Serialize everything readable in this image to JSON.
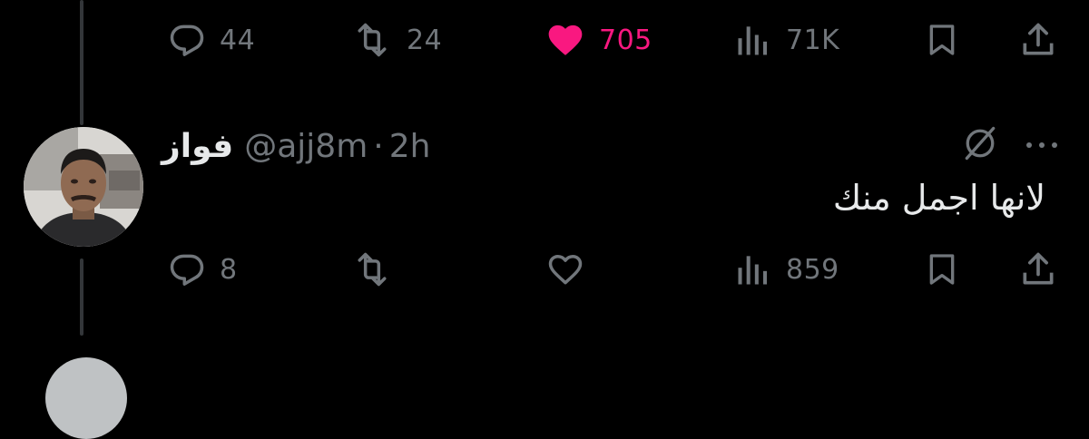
{
  "previous_tweet": {
    "actions": {
      "replies": "44",
      "retweets": "24",
      "likes": "705",
      "views": "71K"
    }
  },
  "tweet": {
    "display_name": "فواز",
    "handle": "@ajj8m",
    "separator": "·",
    "time": "2h",
    "text": "لانها اجمل منك",
    "actions": {
      "replies": "8",
      "retweets": "",
      "likes": "",
      "views": "859"
    }
  },
  "icons": {
    "reply": "reply-icon",
    "retweet": "retweet-icon",
    "like": "heart-icon",
    "views": "views-icon",
    "bookmark": "bookmark-icon",
    "share": "share-icon",
    "grok": "grok-icon",
    "more": "more-icon"
  },
  "colors": {
    "background": "#000000",
    "text_primary": "#e7e9ea",
    "text_secondary": "#71767b",
    "like_active": "#f91880",
    "thread_line": "#333639"
  }
}
